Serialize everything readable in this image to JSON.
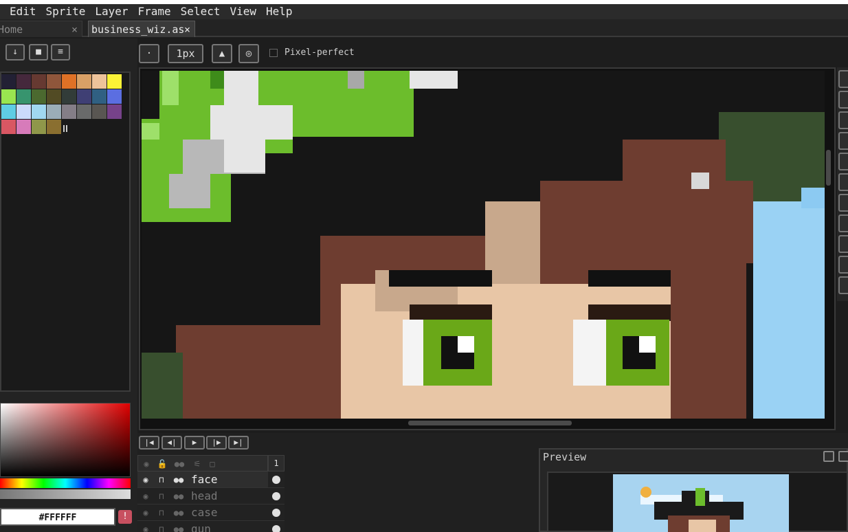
{
  "menubar": {
    "items": [
      "Edit",
      "Sprite",
      "Layer",
      "Frame",
      "Select",
      "View",
      "Help"
    ]
  },
  "tabs": [
    {
      "label": "Home",
      "close": "×"
    },
    {
      "label": "business_wiz.as",
      "close": "×"
    }
  ],
  "toolbar": {
    "brush_size": "1px",
    "pixel_perfect_label": "Pixel-perfect",
    "pixel_perfect_checked": false
  },
  "palette": {
    "colors": [
      "#222034",
      "#45283c",
      "#663931",
      "#8f563b",
      "#df7126",
      "#d9a066",
      "#eec39a",
      "#fbf236",
      "#99e550",
      "#37946e",
      "#4b692f",
      "#524b24",
      "#323c39",
      "#3f3f74",
      "#306082",
      "#5b6ee1",
      "#5fcde4",
      "#cbdbfc",
      "#a0d8f0",
      "#9badb7",
      "#847e87",
      "#696a6a",
      "#595652",
      "#76428a",
      "#d95763",
      "#d77bba",
      "#8f974a",
      "#8a6f30"
    ]
  },
  "color": {
    "hex": "#FFFFFF",
    "warning_icon": "!"
  },
  "layers": {
    "frame_number": "1",
    "rows": [
      {
        "name": "face",
        "selected": true
      },
      {
        "name": "head",
        "selected": false
      },
      {
        "name": "case",
        "selected": false
      },
      {
        "name": "gun",
        "selected": false
      }
    ]
  },
  "preview": {
    "title": "Preview"
  }
}
